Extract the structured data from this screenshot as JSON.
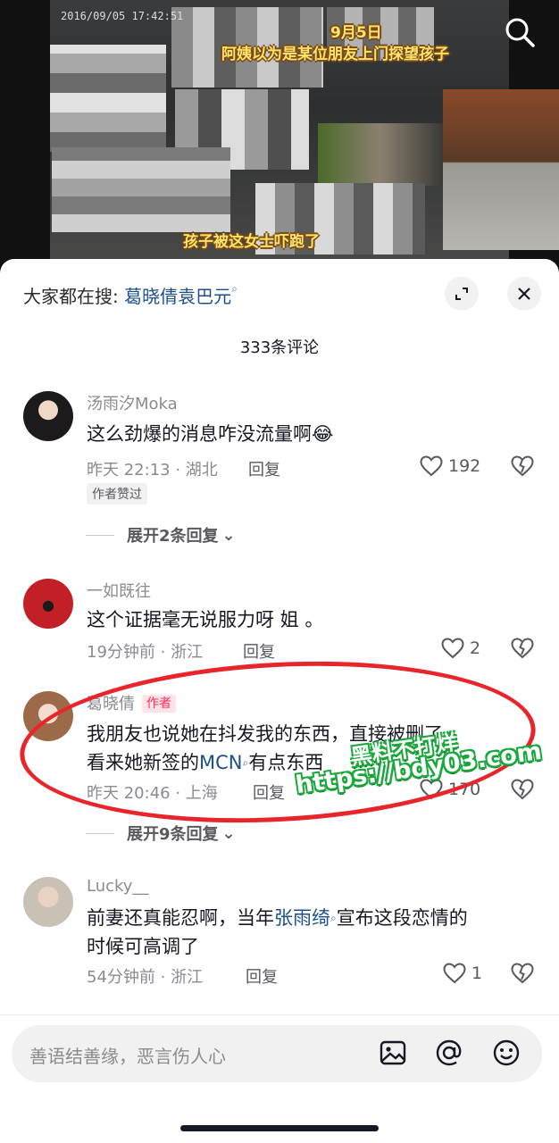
{
  "video": {
    "timestamp": "2016/09/05  17:42:51",
    "caption_date": "9月5日",
    "caption_line1": "阿姨以为是某位朋友上门探望孩子",
    "caption_line2": "孩子被这女士吓跑了"
  },
  "header": {
    "hot_search_label": "大家都在搜:",
    "hot_search_keyword": "葛晓倩袁巴元",
    "comment_count": "333条评论"
  },
  "comments": [
    {
      "username": "汤雨汐Moka",
      "text": "这么劲爆的消息咋没流量啊😂",
      "meta": "昨天 22:13 · 湖北",
      "reply_label": "回复",
      "likes": "192",
      "badge": "作者赞过",
      "expand_label": "展开2条回复"
    },
    {
      "username": "一如既往",
      "text": "这个证据毫无说服力呀 姐 。",
      "meta": "19分钟前 · 浙江",
      "reply_label": "回复",
      "likes": "2"
    },
    {
      "username": "葛晓倩",
      "author_tag": "作者",
      "text_line1": "我朋友也说她在抖发我的东西，直接被删了，",
      "text_line2_prefix": "看来她新签的",
      "text_link": "MCN",
      "text_line2_suffix": "有点东西",
      "meta": "昨天 20:46 · 上海",
      "reply_label": "回复",
      "likes": "170",
      "expand_label": "展开9条回复"
    },
    {
      "username": "Lucky__",
      "text_prefix": "前妻还真能忍啊，当年",
      "text_link": "张雨绮",
      "text_suffix": "宣布这段恋情的",
      "text_line2": "时候可高调了",
      "meta": "54分钟前 · 浙江",
      "reply_label": "回复",
      "likes": "1"
    }
  ],
  "watermark": {
    "line1": "黑料不打烊",
    "line2": "https://bdy03.com"
  },
  "input": {
    "placeholder": "善语结善缘，恶言伤人心"
  },
  "colors": {
    "link": "#1b4f8c",
    "author_tag": "#fe2c55",
    "annotation_circle": "#e8252b",
    "watermark_outline": "#1aa83c"
  },
  "icons": [
    "search-icon",
    "expand-icon",
    "close-icon",
    "heart-icon",
    "dislike-icon",
    "image-icon",
    "at-icon",
    "emoji-icon"
  ]
}
